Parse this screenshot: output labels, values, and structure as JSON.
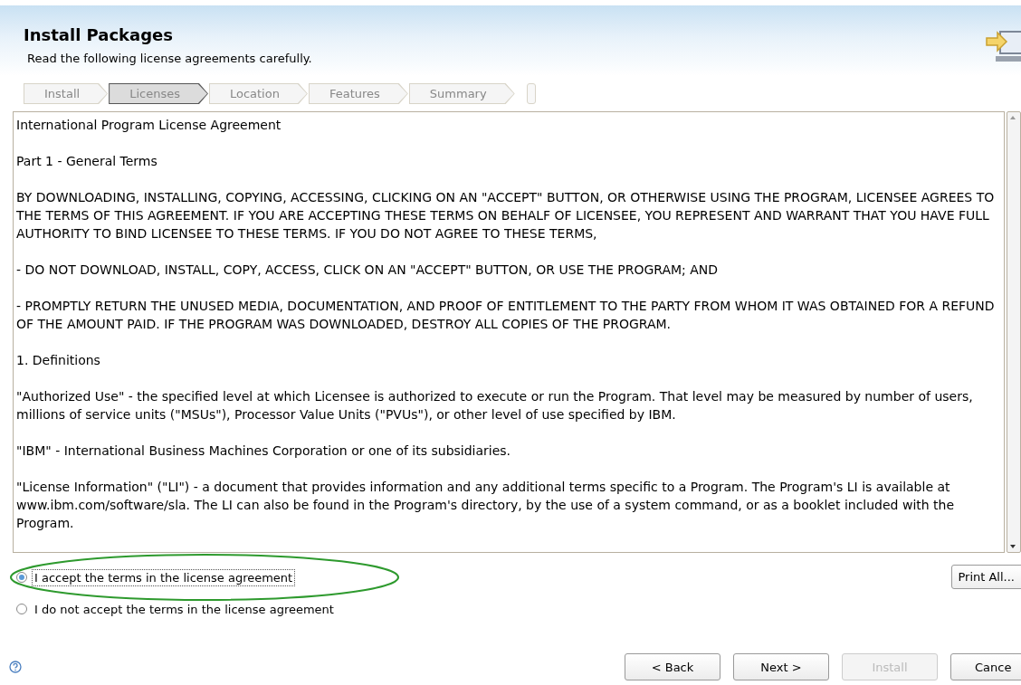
{
  "header": {
    "title": "Install Packages",
    "subtitle": "Read the following license agreements carefully."
  },
  "steps": [
    {
      "label": "Install",
      "selected": false
    },
    {
      "label": "Licenses",
      "selected": true
    },
    {
      "label": "Location",
      "selected": false
    },
    {
      "label": "Features",
      "selected": false
    },
    {
      "label": "Summary",
      "selected": false
    }
  ],
  "license_text": [
    "International Program License Agreement",
    "Part 1 - General Terms",
    "BY DOWNLOADING, INSTALLING, COPYING, ACCESSING, CLICKING ON AN \"ACCEPT\" BUTTON, OR OTHERWISE USING THE PROGRAM, LICENSEE AGREES TO THE TERMS OF THIS AGREEMENT. IF YOU ARE ACCEPTING THESE TERMS ON BEHALF OF LICENSEE, YOU REPRESENT AND WARRANT THAT YOU HAVE FULL AUTHORITY TO BIND LICENSEE TO THESE TERMS. IF YOU DO NOT AGREE TO THESE TERMS,",
    "- DO NOT DOWNLOAD, INSTALL, COPY, ACCESS, CLICK ON AN \"ACCEPT\" BUTTON, OR USE THE PROGRAM; AND",
    "- PROMPTLY RETURN THE UNUSED MEDIA, DOCUMENTATION, AND PROOF OF ENTITLEMENT TO THE PARTY FROM WHOM IT WAS OBTAINED FOR A REFUND OF THE AMOUNT PAID. IF THE PROGRAM WAS DOWNLOADED, DESTROY ALL COPIES OF THE PROGRAM.",
    "1. Definitions",
    "\"Authorized Use\" - the specified level at which Licensee is authorized to execute or run the Program. That level may be measured by number of users, millions of service units (\"MSUs\"), Processor Value Units (\"PVUs\"), or other level of use specified by IBM.",
    "\"IBM\" - International Business Machines Corporation or one of its subsidiaries.",
    "\"License Information\" (\"LI\") - a document that provides information and any additional terms specific to a Program. The Program's LI is available at www.ibm.com/software/sla. The LI can also be found in the Program's directory, by the use of a system command, or as a booklet included with the Program."
  ],
  "options": [
    {
      "label": "I accept the terms in the license agreement",
      "selected": true,
      "highlighted": true
    },
    {
      "label": "I do not accept the terms in the license agreement",
      "selected": false,
      "highlighted": false
    }
  ],
  "print_button": "Print All...",
  "buttons": [
    {
      "label": "< Back",
      "disabled": false
    },
    {
      "label": "Next >",
      "disabled": false
    },
    {
      "label": "Install",
      "disabled": true
    },
    {
      "label": "Cance",
      "disabled": false
    }
  ]
}
